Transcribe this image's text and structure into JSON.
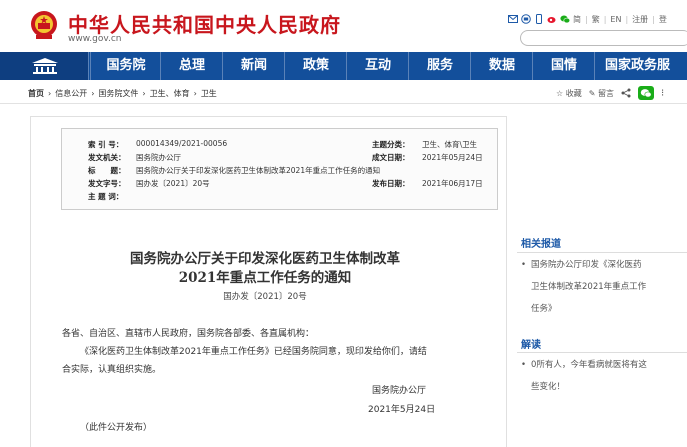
{
  "header": {
    "site_title": "中华人民共和国中央人民政府",
    "site_url": "www.gov.cn",
    "lang_links": [
      "简",
      "繁",
      "EN",
      "注册",
      "登"
    ]
  },
  "nav": [
    "国务院",
    "总理",
    "新闻",
    "政策",
    "互动",
    "服务",
    "数据",
    "国情",
    "国家政务服"
  ],
  "breadcrumb": [
    "首页",
    "信息公开",
    "国务院文件",
    "卫生、体育",
    "卫生"
  ],
  "tools": {
    "favorite": "收藏",
    "comment": "留言"
  },
  "meta": {
    "index_label": "索 引 号：",
    "index_value": "000014349/2021-00056",
    "theme_label": "主题分类：",
    "theme_value": "卫生、体育\\卫生",
    "issuer_label": "发文机关：",
    "issuer_value": "国务院办公厅",
    "created_label": "成文日期：",
    "created_value": "2021年05月24日",
    "title_label": "标　　题：",
    "title_value": "国务院办公厅关于印发深化医药卫生体制改革2021年重点工作任务的通知",
    "docno_label": "发文字号：",
    "docno_value": "国办发〔2021〕20号",
    "published_label": "发布日期：",
    "published_value": "2021年06月17日",
    "keywords_label": "主 题 词："
  },
  "document": {
    "title_line1": "国务院办公厅关于印发深化医药卫生体制改革",
    "title_line2": "2021年重点工作任务的通知",
    "number": "国办发〔2021〕20号",
    "salutation": "各省、自治区、直辖市人民政府，国务院各部委、各直属机构：",
    "para1_line1": "《深化医药卫生体制改革2021年重点工作任务》已经国务院同意，现印发给你们，请结",
    "para1_line2": "合实际，认真组织实施。",
    "signature": "国务院办公厅",
    "date": "2021年5月24日",
    "public_note": "（此件公开发布）"
  },
  "sidebar": {
    "related_title": "相关报道",
    "related_item": "国务院办公厅印发《深化医药卫生体制改革2021年重点工作任务》",
    "related_lines": [
      "国务院办公厅印发《深化医药",
      "卫生体制改革2021年重点工作",
      "任务》"
    ],
    "interpret_title": "解读",
    "interpret_lines": [
      "0所有人，今年看病就医将有这",
      "些变化！"
    ]
  }
}
